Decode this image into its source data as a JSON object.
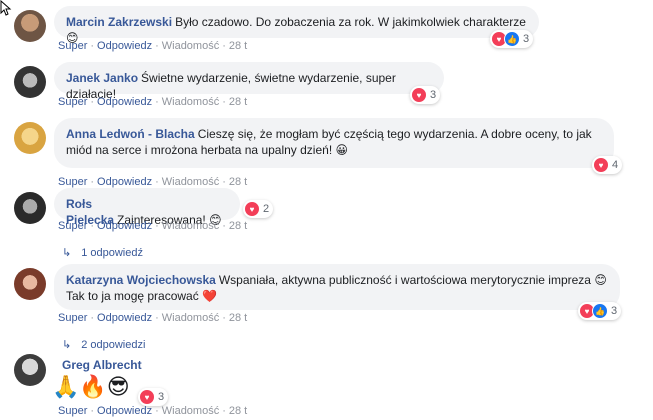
{
  "comments": [
    {
      "author": "Marcin Zakrzewski",
      "text": "Było czadowo. Do zobaczenia za rok. W jakimkolwiek charakterze 😊",
      "reaction_count": "3",
      "actions": {
        "like": "Super",
        "reply": "Odpowiedz",
        "message": "Wiadomość",
        "time": "28 t"
      }
    },
    {
      "author": "Janek Janko",
      "text": "Świetne wydarzenie, świetne wydarzenie, super działacie!",
      "reaction_count": "3",
      "actions": {
        "like": "Super",
        "reply": "Odpowiedz",
        "message": "Wiadomość",
        "time": "28 t"
      }
    },
    {
      "author": "Anna Ledwoń - Blacha",
      "text": "Cieszę się, że mogłam być częścią tego wydarzenia. A dobre oceny, to jak miód na serce i mrożona herbata na upalny dzień! 😀",
      "reaction_count": "4",
      "actions": {
        "like": "Super",
        "reply": "Odpowiedz",
        "message": "Wiadomość",
        "time": "28 t"
      }
    },
    {
      "author": "Rołs Pielecka",
      "text": "Zainteresowana! 😊",
      "reaction_count": "2",
      "actions": {
        "like": "Super",
        "reply": "Odpowiedz",
        "message": "Wiadomość",
        "time": "28 t"
      },
      "replies": "1 odpowiedź"
    },
    {
      "author": "Katarzyna Wojciechowska",
      "text": "Wspaniała, aktywna publiczność i wartościowa merytorycznie impreza 😊 Tak to ja mogę pracować ❤️",
      "reaction_count": "3",
      "actions": {
        "like": "Super",
        "reply": "Odpowiedz",
        "message": "Wiadomość",
        "time": "28 t"
      },
      "replies": "2 odpowiedzi"
    },
    {
      "author": "Greg Albrecht",
      "emojis": "🙏🔥😎",
      "reaction_count": "3",
      "actions": {
        "like": "Super",
        "reply": "Odpowiedz",
        "message": "Wiadomość",
        "time": "28 t"
      }
    }
  ],
  "colors": {
    "link": "#385898",
    "bubble": "#f2f3f5",
    "heart": "#f33e58",
    "like": "#1877f2"
  }
}
